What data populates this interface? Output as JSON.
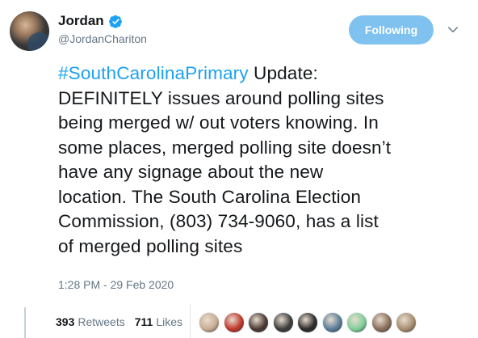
{
  "user": {
    "display_name": "Jordan",
    "handle": "@JordanChariton",
    "verified": true
  },
  "follow_button": {
    "label": "Following"
  },
  "tweet": {
    "hashtag": "#SouthCarolinaPrimary",
    "line1_rest": " Update:",
    "lines": [
      "DEFINITELY issues around polling sites",
      "being merged w/ out voters knowing. In",
      "some places, merged polling site doesn’t",
      "have any signage about the new",
      "location. The South Carolina Election",
      "Commission, (803) 734-9060, has a list",
      "of merged polling sites"
    ],
    "timestamp": "1:28 PM - 29 Feb 2020"
  },
  "stats": {
    "retweets_count": "393",
    "retweets_label": "Retweets",
    "likes_count": "711",
    "likes_label": "Likes"
  },
  "liker_avatars": [
    {
      "name": "liker-avatar-1",
      "color": "#c9ad93"
    },
    {
      "name": "liker-avatar-2",
      "color": "#c0392b"
    },
    {
      "name": "liker-avatar-3",
      "color": "#4a3a33"
    },
    {
      "name": "liker-avatar-4",
      "color": "#3c3c3c"
    },
    {
      "name": "liker-avatar-5",
      "color": "#2a2a2a"
    },
    {
      "name": "liker-avatar-6",
      "color": "#5b7d99"
    },
    {
      "name": "liker-avatar-7",
      "color": "#7fcf9a"
    },
    {
      "name": "liker-avatar-8",
      "color": "#8a6e5a"
    },
    {
      "name": "liker-avatar-9",
      "color": "#a88d6f"
    }
  ]
}
